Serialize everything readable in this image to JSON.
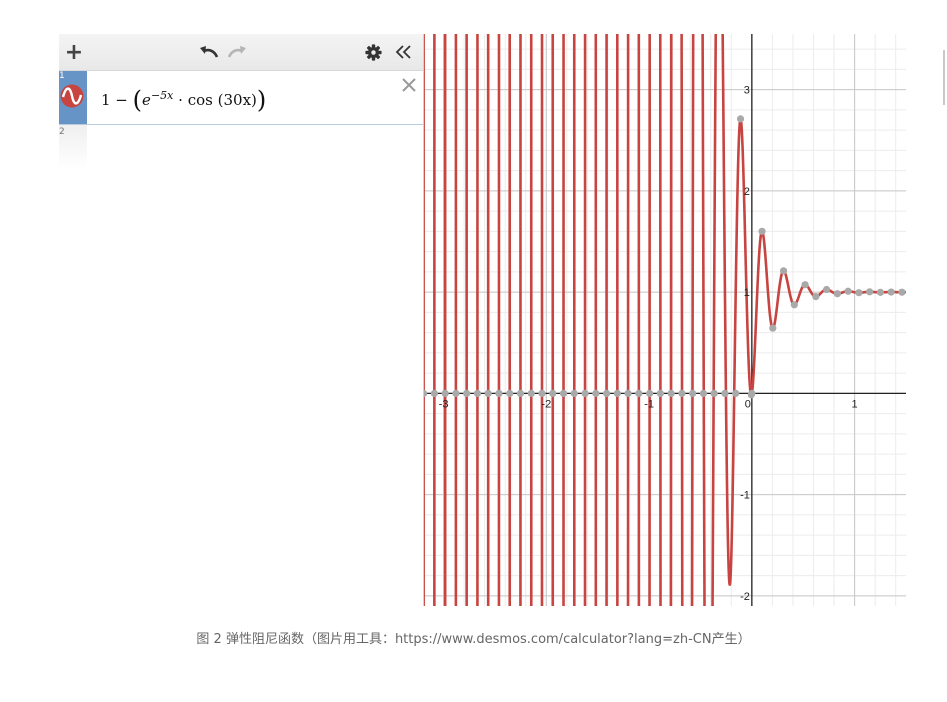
{
  "toolbar": {
    "add_label": "+",
    "icons": [
      "plus-icon",
      "undo-icon",
      "redo-icon",
      "gear-icon",
      "double-chevron-left-icon"
    ]
  },
  "expressions": [
    {
      "index": "1",
      "color": "#c74440",
      "latex": "1-\\left(e^{-5x}\\cdot\\cos\\left(30x\\right)\\right)",
      "display": {
        "lead": "1 −",
        "base": "e",
        "exponent": "−5x",
        "op": "·",
        "func": "cos",
        "arg": "(30x)"
      }
    },
    {
      "index": "2"
    }
  ],
  "graph": {
    "x_ticks": [
      "-3",
      "-2",
      "-1",
      "0",
      "1"
    ],
    "y_ticks": [
      "3",
      "2",
      "1",
      "-1",
      "-2"
    ],
    "x_range": [
      -3.2,
      1.5
    ],
    "y_range": [
      -2.1,
      3.55
    ],
    "curve_color": "#c74440",
    "point_color": "#a9a9a9",
    "grid": true
  },
  "caption": "图 2 弹性阻尼函数（图片用工具：https://www.desmos.com/calculator?lang=zh-CN产生）"
}
